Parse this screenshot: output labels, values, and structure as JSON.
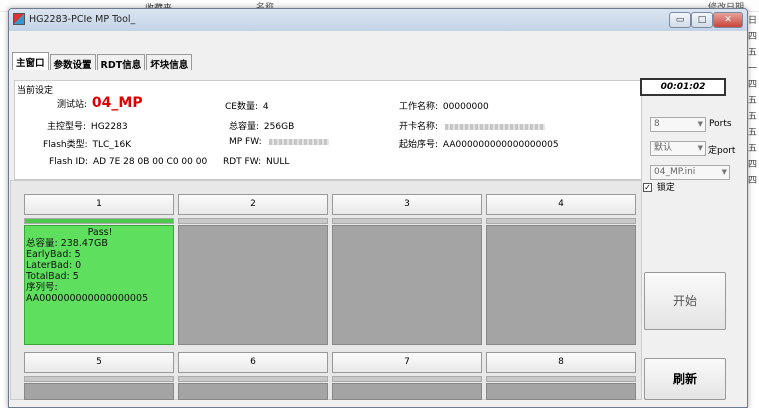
{
  "background": {
    "favorites_label": "收藏夹",
    "col_name": "名称",
    "col_date": "修改日期",
    "right_strip": [
      "日",
      "四",
      "五",
      "一",
      "四",
      "五",
      "五",
      "五",
      "五",
      "四",
      "四"
    ]
  },
  "window": {
    "title": "HG2283-PCIe MP Tool_",
    "min_label": "▭",
    "max_label": "□",
    "close_label": "✕"
  },
  "tabs": [
    "主窗口",
    "参数设置",
    "RDT信息",
    "坏块信息"
  ],
  "settings": {
    "title": "当前设定",
    "station_label": "测试站:",
    "station_value": "04_MP",
    "controller_label": "主控型号:",
    "controller_value": "HG2283",
    "flash_type_label": "Flash类型:",
    "flash_type_value": "TLC_16K",
    "flash_id_label": "Flash ID:",
    "flash_id_value": "AD 7E 28 0B 00 C0 00 00",
    "ce_label": "CE数量:",
    "ce_value": "4",
    "capacity_label": "总容量:",
    "capacity_value": "256GB",
    "mp_fw_label": "MP FW:",
    "rdt_fw_label": "RDT FW:",
    "rdt_fw_value": "NULL",
    "work_label": "工作名称:",
    "work_value": "00000000",
    "card_label": "开卡名称:",
    "serial_label": "起始序号:",
    "serial_value": "AA000000000000000005"
  },
  "controls": {
    "timer": "00:01:02",
    "ports_value": "8",
    "ports_label": "Ports",
    "port_mode_value": "默认",
    "port_mode_label": "定port",
    "ini_value": "04_MP.ini",
    "lock_label": "锁定",
    "start_label": "开始",
    "refresh_label": "刷新"
  },
  "ports": {
    "row1": [
      "1",
      "2",
      "3",
      "4"
    ],
    "row2": [
      "5",
      "6",
      "7",
      "8"
    ],
    "port1": {
      "status": "Pass!",
      "capacity": "总容量: 238.47GB",
      "early_bad": "EarlyBad: 5",
      "later_bad": "LaterBad: 0",
      "total_bad": "TotalBad: 5",
      "serial_label": "序列号:",
      "serial": "AA000000000000000005"
    }
  },
  "colors": {
    "pass_green": "#5ee05e",
    "idle_gray": "#a4a4a4",
    "station_red": "#e00000"
  }
}
